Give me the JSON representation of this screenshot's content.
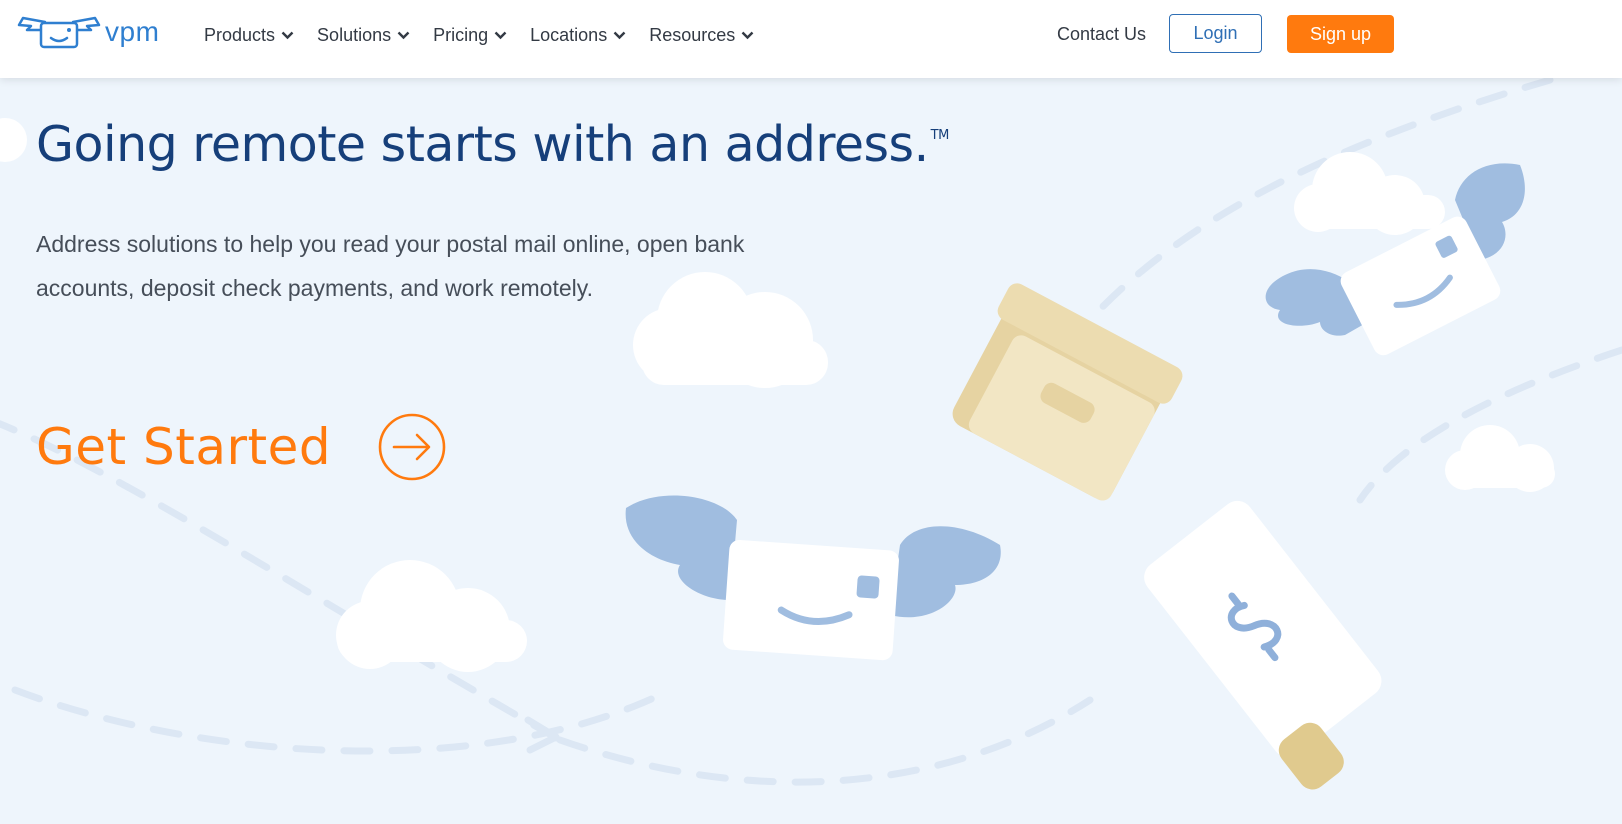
{
  "brand": {
    "logo_text": "vpm",
    "accent": "#ff7a0e",
    "primary": "#163f7a",
    "link": "#2f6fb5"
  },
  "nav": {
    "items": [
      {
        "label": "Products"
      },
      {
        "label": "Solutions"
      },
      {
        "label": "Pricing"
      },
      {
        "label": "Locations"
      },
      {
        "label": "Resources"
      }
    ],
    "contact_label": "Contact Us",
    "login_label": "Login",
    "signup_label": "Sign up"
  },
  "hero": {
    "title": "Going remote starts with an address.",
    "trademark": "TM",
    "subtitle": "Address solutions to help you read your postal mail online, open bank accounts, deposit check payments, and work remotely.",
    "cta_label": "Get Started"
  },
  "icons": {
    "logo": "winged-envelope-logo-icon",
    "nav_chevron": "chevron-down-icon",
    "cta": "arrow-right-circle-icon",
    "illustrations": [
      "cloud-icon",
      "winged-envelope-icon",
      "box-icon",
      "check-icon"
    ]
  }
}
